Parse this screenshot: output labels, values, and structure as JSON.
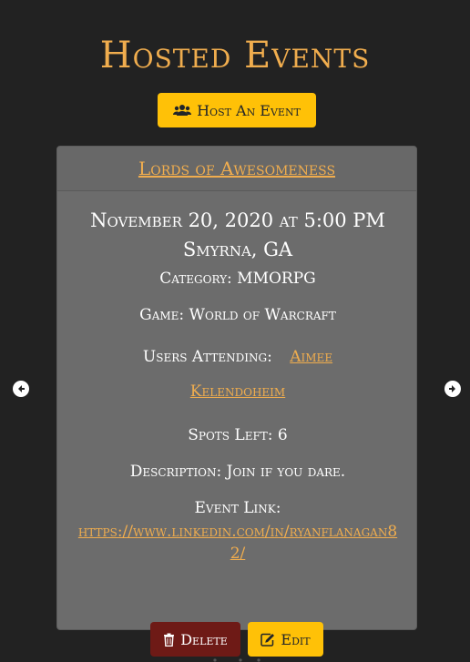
{
  "header": {
    "title": "Hosted Events",
    "host_button_label": "Host An Event"
  },
  "event": {
    "name": "Lords of Awesomeness",
    "datetime": "November 20, 2020 at 5:00 PM",
    "location": "Smyrna, GA",
    "category": "Category: MMORPG",
    "game": "Game: World of Warcraft",
    "users_label": "Users Attending:",
    "users": [
      "Aimee",
      "Kelendoheim"
    ],
    "spots_left": "Spots Left: 6",
    "description": "Description: Join if you dare.",
    "link_label": "Event Link:",
    "link_url": "https://www.linkedin.com/in/ryanflanagan82/",
    "delete_label": "Delete",
    "edit_label": "Edit"
  },
  "colors": {
    "background": "#222222",
    "accent": "#f0ad4e",
    "warning": "#ffc107",
    "danger": "#6e1a16",
    "card": "#6c6c6c"
  },
  "icons": {
    "host": "users-icon",
    "delete": "trash-icon",
    "edit": "edit-icon",
    "prev": "arrow-left-icon",
    "next": "arrow-right-icon"
  }
}
